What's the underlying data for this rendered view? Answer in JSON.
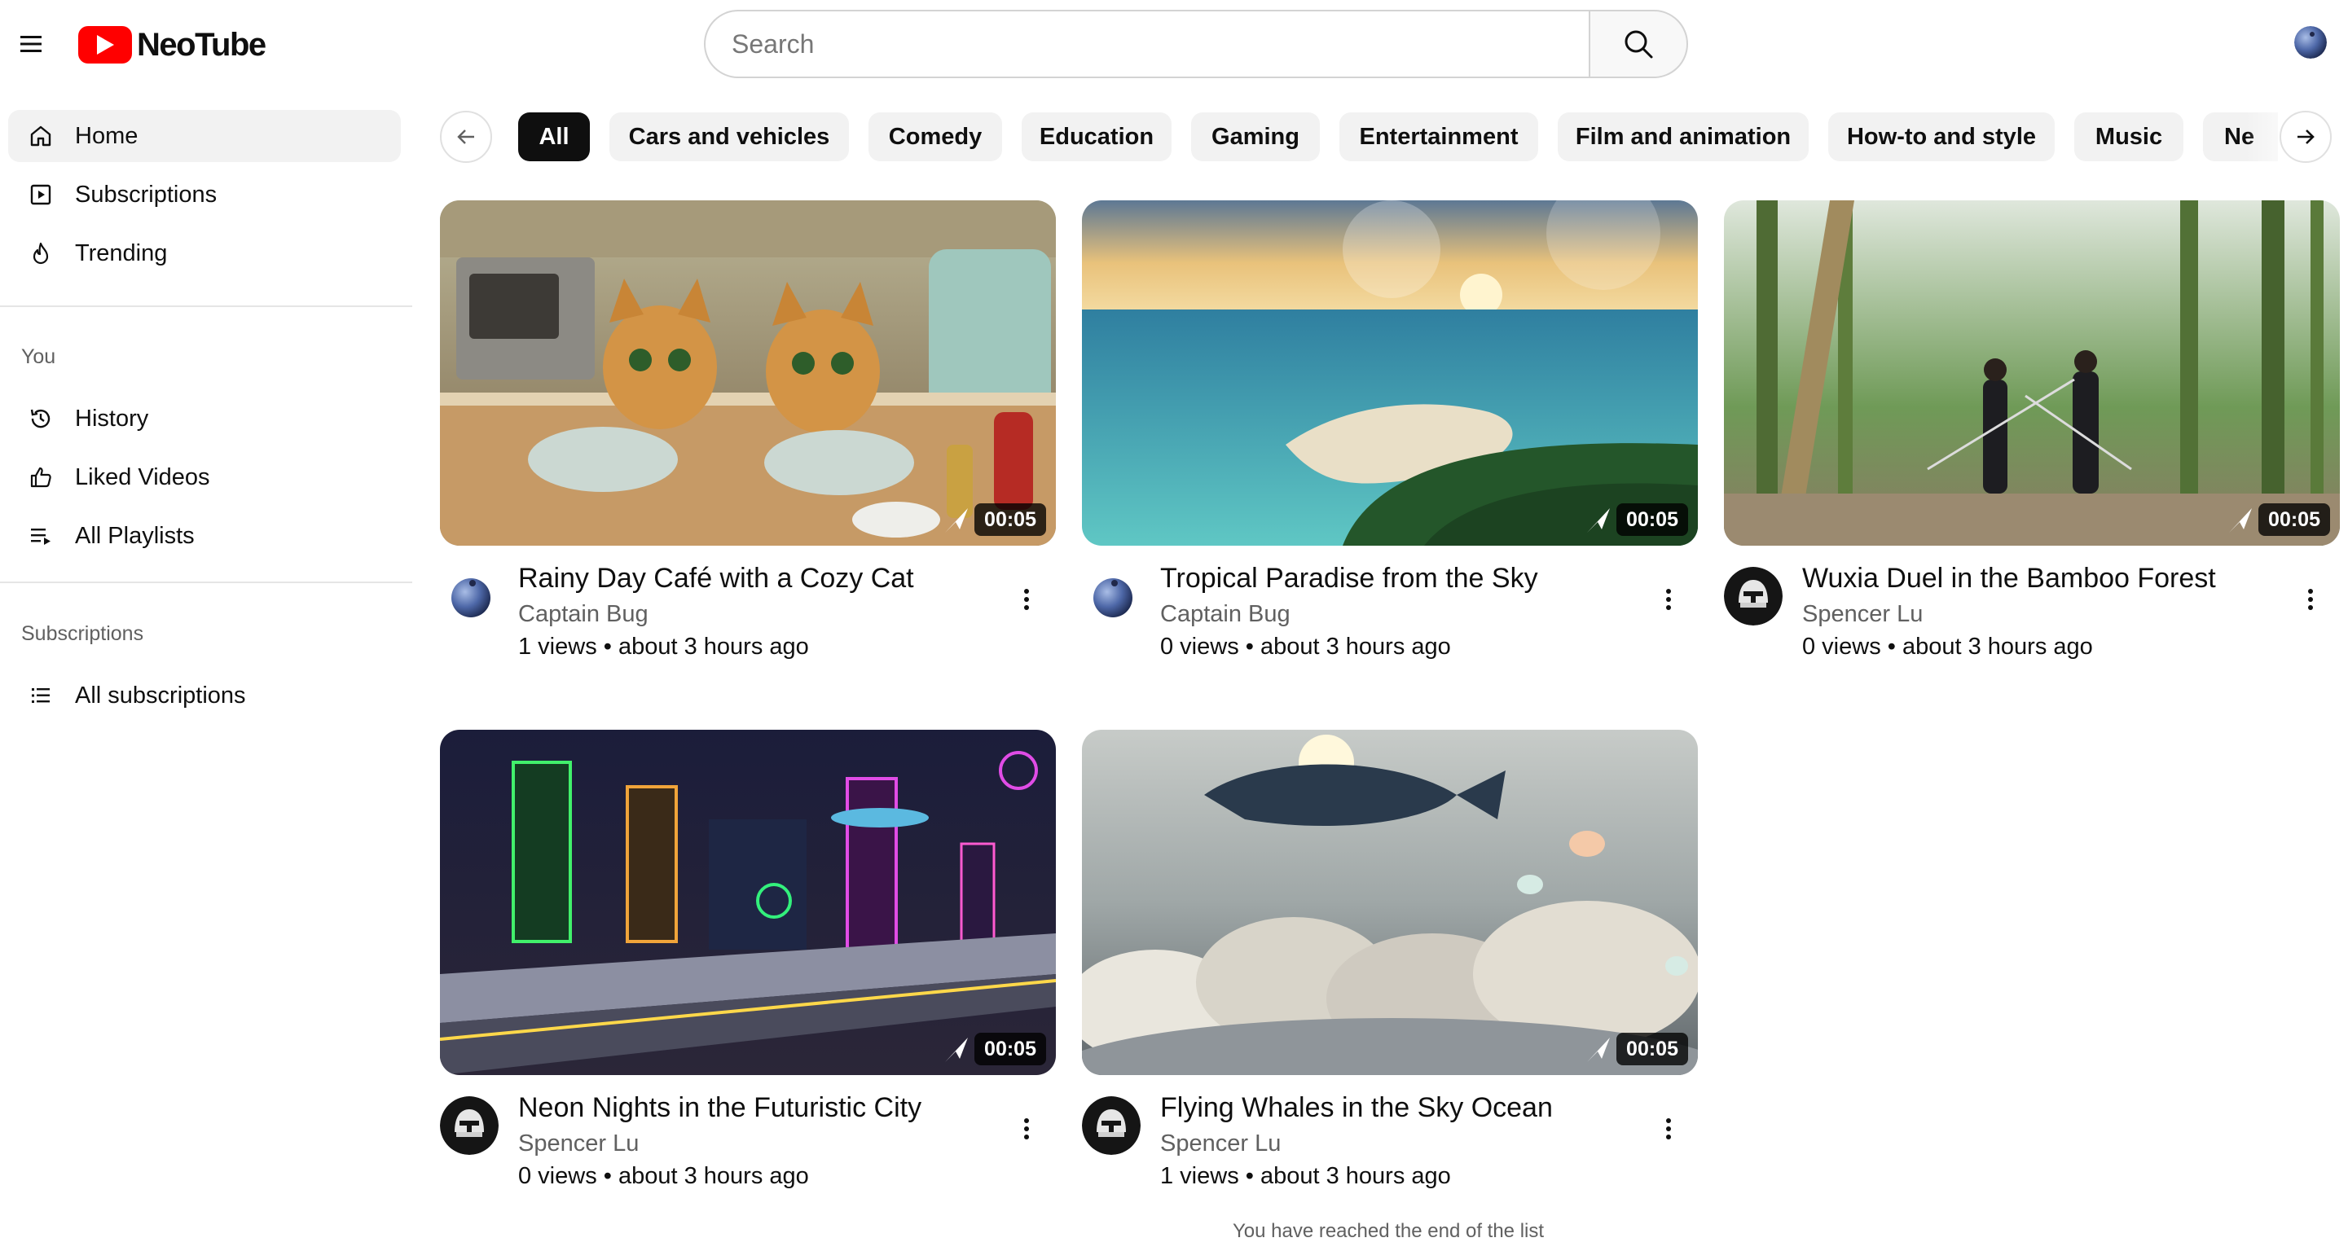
{
  "app": {
    "name": "NeoTube",
    "brand_color": "#ff0000"
  },
  "header": {
    "menu_icon": "hamburger-menu-icon",
    "search": {
      "placeholder": "Search",
      "value": ""
    },
    "search_icon": "search-icon"
  },
  "sidebar": {
    "main_items": [
      {
        "label": "Home",
        "icon": "home-icon",
        "active": true
      },
      {
        "label": "Subscriptions",
        "icon": "subscriptions-icon",
        "active": false
      },
      {
        "label": "Trending",
        "icon": "fire-icon",
        "active": false
      }
    ],
    "you_heading": "You",
    "you_items": [
      {
        "label": "History",
        "icon": "history-icon"
      },
      {
        "label": "Liked Videos",
        "icon": "thumbs-up-icon"
      },
      {
        "label": "All Playlists",
        "icon": "playlist-icon"
      }
    ],
    "subs_heading": "Subscriptions",
    "subs_items": [
      {
        "label": "All subscriptions",
        "icon": "list-icon"
      }
    ]
  },
  "chips": [
    {
      "label": "All",
      "selected": true
    },
    {
      "label": "Cars and vehicles",
      "selected": false
    },
    {
      "label": "Comedy",
      "selected": false
    },
    {
      "label": "Education",
      "selected": false
    },
    {
      "label": "Gaming",
      "selected": false
    },
    {
      "label": "Entertainment",
      "selected": false
    },
    {
      "label": "Film and animation",
      "selected": false
    },
    {
      "label": "How-to and style",
      "selected": false
    },
    {
      "label": "Music",
      "selected": false
    },
    {
      "label": "Ne",
      "selected": false
    }
  ],
  "videos": [
    {
      "title": "Rainy Day Café with a Cozy Cat",
      "channel": "Captain Bug",
      "views": "1 views",
      "age": "about 3 hours ago",
      "meta": "1 views • about 3 hours ago",
      "duration": "00:05",
      "avatar": "blueberry"
    },
    {
      "title": "Tropical Paradise from the Sky",
      "channel": "Captain Bug",
      "views": "0 views",
      "age": "about 3 hours ago",
      "meta": "0 views • about 3 hours ago",
      "duration": "00:05",
      "avatar": "blueberry"
    },
    {
      "title": "Wuxia Duel in the Bamboo Forest",
      "channel": "Spencer Lu",
      "views": "0 views",
      "age": "about 3 hours ago",
      "meta": "0 views • about 3 hours ago",
      "duration": "00:05",
      "avatar": "helmet"
    },
    {
      "title": "Neon Nights in the Futuristic City",
      "channel": "Spencer Lu",
      "views": "0 views",
      "age": "about 3 hours ago",
      "meta": "0 views • about 3 hours ago",
      "duration": "00:05",
      "avatar": "helmet"
    },
    {
      "title": "Flying Whales in the Sky Ocean",
      "channel": "Spencer Lu",
      "views": "1 views",
      "age": "about 3 hours ago",
      "meta": "1 views • about 3 hours ago",
      "duration": "00:05",
      "avatar": "helmet"
    }
  ],
  "end_of_list": "You have reached the end of the list"
}
